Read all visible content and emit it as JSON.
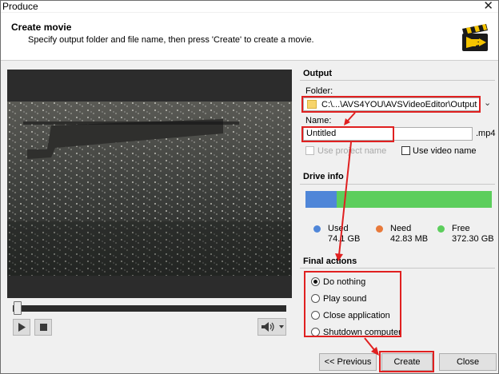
{
  "window": {
    "title": "Produce"
  },
  "header": {
    "title": "Create movie",
    "subtitle": "Specify output folder and file name, then press 'Create' to create a movie."
  },
  "player": {
    "play_icon": "play-icon",
    "stop_icon": "stop-icon",
    "volume_icon": "volume-icon"
  },
  "output": {
    "group_label": "Output",
    "folder_label": "Folder:",
    "folder_value": "C:\\...\\AVS4YOU\\AVSVideoEditor\\Output",
    "name_label": "Name:",
    "name_value": "Untitled",
    "extension": ".mp4",
    "use_project_name": "Use project name",
    "use_video_name": "Use video name"
  },
  "drive": {
    "group_label": "Drive info",
    "used_label": "Used",
    "used_value": "74.1 GB",
    "need_label": "Need",
    "need_value": "42.83 MB",
    "free_label": "Free",
    "free_value": "372.30 GB",
    "used_fraction": 0.166,
    "colors": {
      "used": "#4f86d8",
      "need": "#e8793a",
      "free": "#5cce5c"
    }
  },
  "final_actions": {
    "group_label": "Final actions",
    "options": [
      "Do nothing",
      "Play sound",
      "Close application",
      "Shutdown computer"
    ],
    "selected": "Do nothing"
  },
  "buttons": {
    "previous": "<< Previous",
    "create": "Create",
    "close": "Close"
  },
  "annotations": {
    "highlight_color": "#e02020"
  }
}
